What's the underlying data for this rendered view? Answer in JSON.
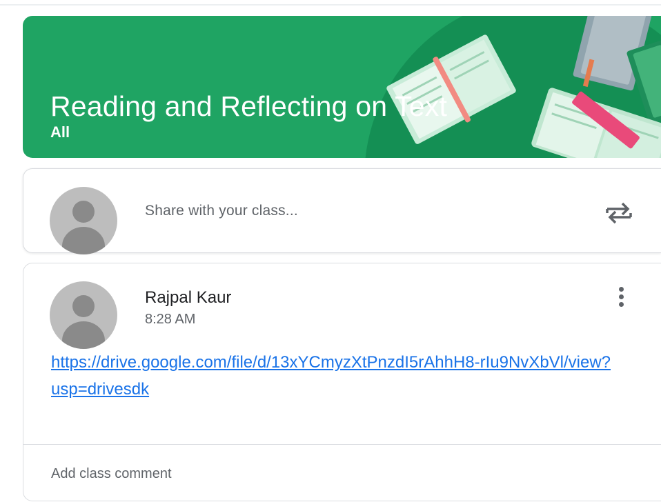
{
  "banner": {
    "title": "Reading and Reflecting on Text",
    "subtitle": "All",
    "color": "#1fa463"
  },
  "share": {
    "placeholder": "Share with your class...",
    "icon": "repost-swap-icon"
  },
  "post": {
    "author": "Rajpal Kaur",
    "time": "8:28 AM",
    "link": "https://drive.google.com/file/d/13xYCmyzXtPnzdI5rAhhH8-rIu9NvXbVl/view?usp=drivesdk",
    "menu_icon": "more-vert-icon",
    "comment_placeholder": "Add class comment"
  },
  "colors": {
    "link": "#1a73e8",
    "text_secondary": "#5f6368"
  }
}
